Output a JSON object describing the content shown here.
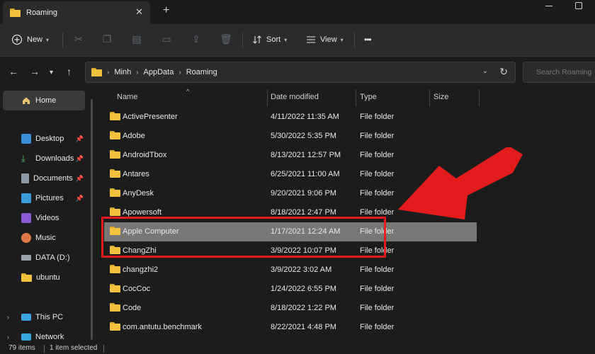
{
  "tab": {
    "title": "Roaming",
    "new_tab": "+"
  },
  "commands": {
    "new": "New",
    "sort": "Sort",
    "view": "View",
    "more": "•••"
  },
  "address": {
    "breadcrumbs": [
      "Minh",
      "AppData",
      "Roaming"
    ]
  },
  "search": {
    "placeholder": "Search Roaming"
  },
  "sidebar": {
    "home": "Home",
    "items": [
      {
        "label": "Desktop",
        "icon": "desktop-icon",
        "pinned": true
      },
      {
        "label": "Downloads",
        "icon": "downloads-icon",
        "pinned": true
      },
      {
        "label": "Documents",
        "icon": "documents-icon",
        "pinned": true
      },
      {
        "label": "Pictures",
        "icon": "pictures-icon",
        "pinned": true
      },
      {
        "label": "Videos",
        "icon": "videos-icon",
        "pinned": false
      },
      {
        "label": "Music",
        "icon": "music-icon",
        "pinned": false
      },
      {
        "label": "DATA (D:)",
        "icon": "drive-icon",
        "pinned": false
      },
      {
        "label": "ubuntu",
        "icon": "folder-icon",
        "pinned": false
      }
    ],
    "this_pc": "This PC",
    "network": "Network"
  },
  "columns": {
    "name": "Name",
    "date": "Date modified",
    "type": "Type",
    "size": "Size"
  },
  "files": [
    {
      "name": "ActivePresenter",
      "date": "4/11/2022 11:35 AM",
      "type": "File folder",
      "selected": false
    },
    {
      "name": "Adobe",
      "date": "5/30/2022 5:35 PM",
      "type": "File folder",
      "selected": false
    },
    {
      "name": "AndroidTbox",
      "date": "8/13/2021 12:57 PM",
      "type": "File folder",
      "selected": false
    },
    {
      "name": "Antares",
      "date": "6/25/2021 11:00 AM",
      "type": "File folder",
      "selected": false
    },
    {
      "name": "AnyDesk",
      "date": "9/20/2021 9:06 PM",
      "type": "File folder",
      "selected": false
    },
    {
      "name": "Apowersoft",
      "date": "8/18/2021 2:47 PM",
      "type": "File folder",
      "selected": false
    },
    {
      "name": "Apple Computer",
      "date": "1/17/2021 12:24 AM",
      "type": "File folder",
      "selected": true
    },
    {
      "name": "ChangZhi",
      "date": "3/9/2022 10:07 PM",
      "type": "File folder",
      "selected": false
    },
    {
      "name": "changzhi2",
      "date": "3/9/2022 3:02 AM",
      "type": "File folder",
      "selected": false
    },
    {
      "name": "CocCoc",
      "date": "1/24/2022 6:55 PM",
      "type": "File folder",
      "selected": false
    },
    {
      "name": "Code",
      "date": "8/18/2022 1:22 PM",
      "type": "File folder",
      "selected": false
    },
    {
      "name": "com.antutu.benchmark",
      "date": "8/22/2021 4:48 PM",
      "type": "File folder",
      "selected": false
    }
  ],
  "status": {
    "count": "79 items",
    "selection": "1 item selected"
  },
  "colors": {
    "accent_red": "#e21c1c",
    "selected_row": "#777777",
    "folder_yellow": "#f2c23f"
  }
}
